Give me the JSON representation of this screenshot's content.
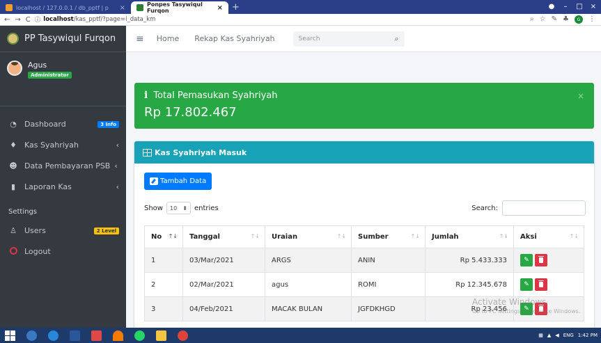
{
  "browser": {
    "tabs": [
      {
        "label": "localhost / 127.0.0.1 / db_pptf | p"
      },
      {
        "label": "Ponpes Tasywiqul Furqon"
      }
    ],
    "address": {
      "host": "localhost",
      "path": "/kas_pptf/?page=i_data_km"
    },
    "new_tab": "+"
  },
  "sidebar": {
    "brand": "PP Tasywiqul Furqon",
    "user": {
      "name": "Agus",
      "role": "Administrator"
    },
    "items": [
      {
        "label": "Dashboard",
        "badge": "3 Info",
        "icon": "dashboard-icon"
      },
      {
        "label": "Kas Syahriyah",
        "chevron": "‹",
        "icon": "bell-icon"
      },
      {
        "label": "Data Pembayaran PSB",
        "chevron": "‹",
        "icon": "users-icon"
      },
      {
        "label": "Laporan Kas",
        "chevron": "‹",
        "icon": "file-icon"
      }
    ],
    "settings_header": "Settings",
    "settings": [
      {
        "label": "Users",
        "badge": "2 Level",
        "icon": "user-icon"
      },
      {
        "label": "Logout",
        "icon": "logout-icon"
      }
    ]
  },
  "topnav": {
    "links": [
      "Home",
      "Rekap Kas Syahriyah"
    ],
    "search_placeholder": "Search"
  },
  "alert": {
    "title": "Total Pemasukan Syahriyah",
    "amount": "Rp 17.802.467",
    "close": "×"
  },
  "card": {
    "title": "Kas Syahriyah Masuk",
    "add_button": "Tambah Data",
    "show_label": "Show",
    "entries_value": "10",
    "entries_label": "entries",
    "search_label": "Search:",
    "columns": [
      "No",
      "Tanggal",
      "Uraian",
      "Sumber",
      "Jumlah",
      "Aksi"
    ],
    "rows": [
      {
        "no": "1",
        "tanggal": "03/Mar/2021",
        "uraian": "ARGS",
        "sumber": "ANIN",
        "jumlah": "Rp 5.433.333"
      },
      {
        "no": "2",
        "tanggal": "02/Mar/2021",
        "uraian": "agus",
        "sumber": "ROMI",
        "jumlah": "Rp 12.345.678"
      },
      {
        "no": "3",
        "tanggal": "04/Feb/2021",
        "uraian": "MACAK BULAN",
        "sumber": "JGFDKHGD",
        "jumlah": "Rp 23.456"
      }
    ]
  },
  "watermark": {
    "line1": "Activate Windows",
    "line2": "Go to PC settings to activate Windows."
  },
  "taskbar": {
    "lang": "ENG",
    "time": "1:42 PM"
  },
  "colors": {
    "sidebar": "#343a40",
    "success": "#28a745",
    "info": "#17a2b8",
    "primary": "#007bff",
    "danger": "#dc3545"
  }
}
